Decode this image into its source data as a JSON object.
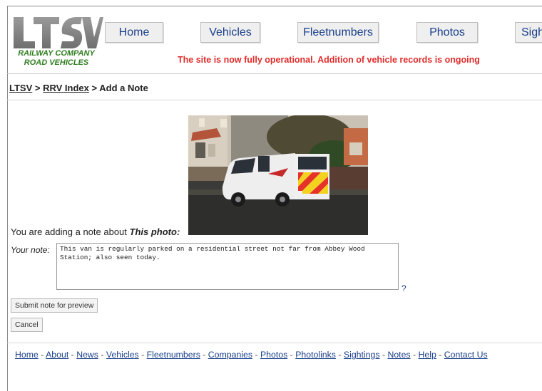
{
  "header": {
    "logo_text": "LTSV",
    "logo_subtitle_line1": "RAILWAY COMPANY",
    "logo_subtitle_line2": "ROAD VEHICLES",
    "nav": [
      "Home",
      "Vehicles",
      "Fleetnumbers",
      "Photos",
      "Sigh"
    ],
    "banner": "The site is now fully operational. Addition of vehicle records is ongoing",
    "banner_color": "#e22b2b"
  },
  "breadcrumb": {
    "items": [
      "LTSV",
      "RRV Index"
    ],
    "separator": ">",
    "current": "Add a Note"
  },
  "main": {
    "adding_note_prefix": "You are adding a note about",
    "adding_note_subject": "This photo:",
    "note_label": "Your note:",
    "note_value": "This van is regularly parked on a residential street not far from Abbey Wood Station; also seen today.",
    "help_icon": "?",
    "submit_label": "Submit note for preview",
    "cancel_label": "Cancel"
  },
  "footer": {
    "links": [
      "Home",
      "About",
      "News",
      "Vehicles",
      "Fleetnumbers",
      "Companies",
      "Photos",
      "Photolinks",
      "Sightings",
      "Notes",
      "Help",
      "Contact Us"
    ],
    "separator": "-"
  }
}
